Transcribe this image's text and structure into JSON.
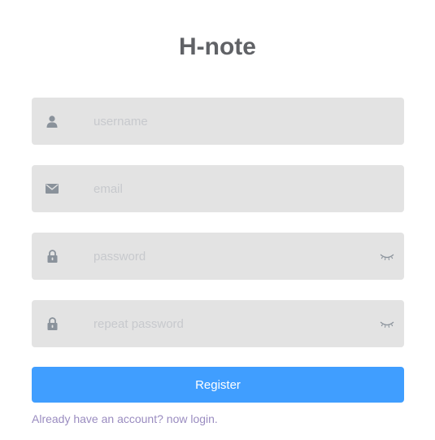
{
  "app": {
    "title": "H-note"
  },
  "form": {
    "username_placeholder": "username",
    "email_placeholder": "email",
    "password_placeholder": "password",
    "repeat_password_placeholder": "repeat password",
    "register_label": "Register",
    "login_link": "Already have an account? now login."
  },
  "icons": {
    "username": "user-icon",
    "email": "envelope-icon",
    "password": "lock-icon",
    "repeat_password": "lock-icon",
    "password_toggle": "eye-closed-icon"
  },
  "colors": {
    "title": "#606266",
    "field_bg": "#e3e3e3",
    "icon": "#8a929b",
    "placeholder": "#c7c9cd",
    "button": "#409eff",
    "link": "#9a8cc0"
  }
}
